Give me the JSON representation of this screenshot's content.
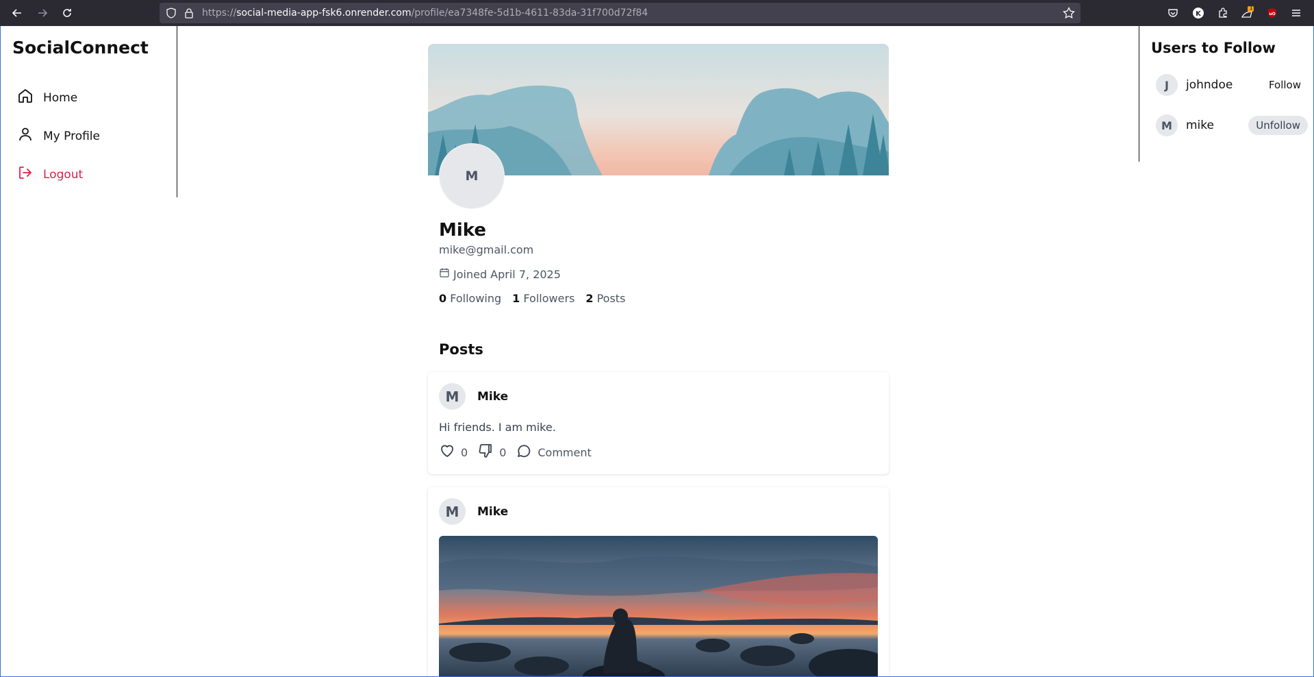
{
  "browser": {
    "url_prefix": "https://",
    "url_host": "social-media-app-fsk6.onrender.com",
    "url_path": "/profile/ea7348fe-5d1b-4611-83da-31f700d72f84",
    "extension_badge": "1"
  },
  "sidebar": {
    "brand": "SocialConnect",
    "items": [
      {
        "label": "Home",
        "icon": "home-icon"
      },
      {
        "label": "My Profile",
        "icon": "user-icon"
      },
      {
        "label": "Logout",
        "icon": "logout-icon"
      }
    ]
  },
  "rightbar": {
    "title": "Users to Follow",
    "users": [
      {
        "initial": "J",
        "name": "johndoe",
        "action": "Follow"
      },
      {
        "initial": "M",
        "name": "mike",
        "action": "Unfollow"
      }
    ]
  },
  "profile": {
    "initial": "M",
    "name": "Mike",
    "email": "mike@gmail.com",
    "joined": "Joined April 7, 2025",
    "stats": [
      {
        "value": "0",
        "label": "Following"
      },
      {
        "value": "1",
        "label": "Followers"
      },
      {
        "value": "2",
        "label": "Posts"
      }
    ]
  },
  "posts_heading": "Posts",
  "posts": [
    {
      "initial": "M",
      "author": "Mike",
      "text": "Hi friends. I am mike.",
      "likes": "0",
      "dislikes": "0",
      "comment_label": "Comment"
    },
    {
      "initial": "M",
      "author": "Mike"
    }
  ],
  "colors": {
    "accent_logout": "#e11d48",
    "avatar_bg": "#e5e7eb",
    "chrome_bg": "#2b2a33"
  }
}
